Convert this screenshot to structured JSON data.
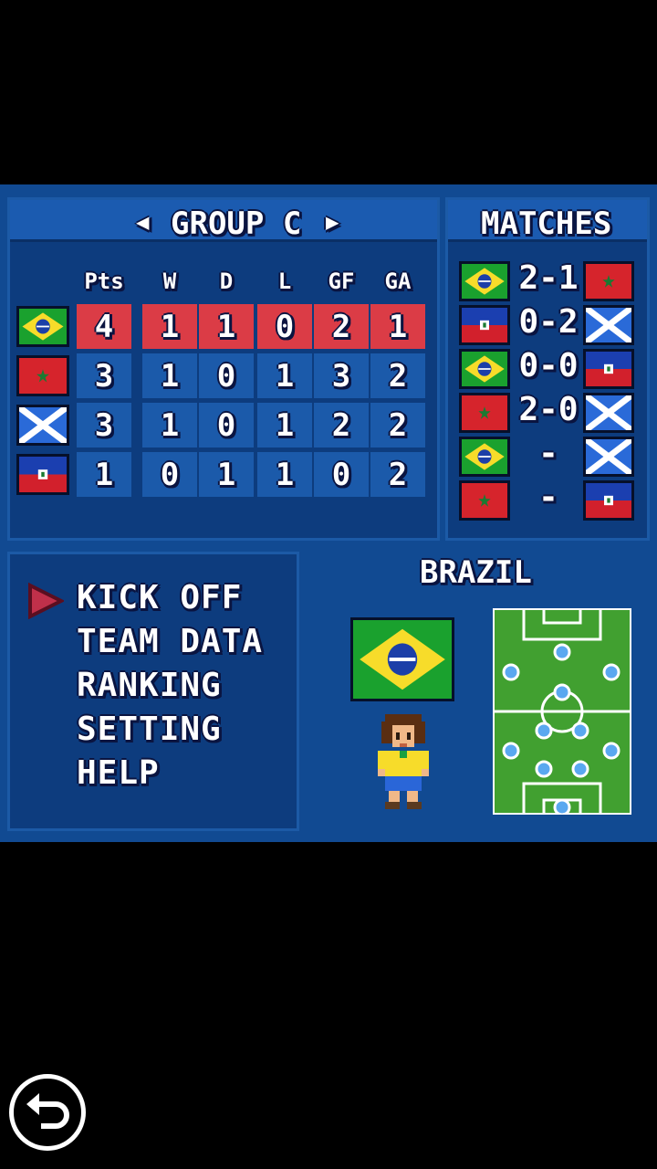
{
  "group": {
    "title": "GROUP C",
    "prev_icon": "triangle-left-icon",
    "next_icon": "triangle-right-icon"
  },
  "matches_title": "MATCHES",
  "columns": [
    "Pts",
    "W",
    "D",
    "L",
    "GF",
    "GA"
  ],
  "standings": [
    {
      "team": "brazil-flag",
      "values": [
        "4",
        "1",
        "1",
        "0",
        "2",
        "1"
      ],
      "highlight": true
    },
    {
      "team": "morocco-flag",
      "values": [
        "3",
        "1",
        "0",
        "1",
        "3",
        "2"
      ],
      "highlight": false
    },
    {
      "team": "scotland-flag",
      "values": [
        "3",
        "1",
        "0",
        "1",
        "2",
        "2"
      ],
      "highlight": false
    },
    {
      "team": "haiti-flag",
      "values": [
        "1",
        "0",
        "1",
        "1",
        "0",
        "2"
      ],
      "highlight": false
    }
  ],
  "matches": [
    {
      "home": "brazil-flag",
      "score": "2-1",
      "away": "morocco-flag"
    },
    {
      "home": "haiti-flag",
      "score": "0-2",
      "away": "scotland-flag"
    },
    {
      "home": "brazil-flag",
      "score": "0-0",
      "away": "haiti-flag"
    },
    {
      "home": "morocco-flag",
      "score": "2-0",
      "away": "scotland-flag"
    },
    {
      "home": "brazil-flag",
      "score": "-",
      "away": "scotland-flag"
    },
    {
      "home": "morocco-flag",
      "score": "-",
      "away": "haiti-flag"
    }
  ],
  "menu": {
    "cursor_icon": "triangle-right-cursor-icon",
    "items": [
      "KICK OFF",
      "TEAM DATA",
      "RANKING",
      "SETTING",
      "HELP"
    ]
  },
  "team": {
    "name": "BRAZIL",
    "flag": "brazil-flag",
    "player": "player-sprite",
    "formation": "formation-pitch"
  },
  "back_icon": "back-arrow-icon",
  "colors": {
    "panel": "#0d3c7e",
    "header": "#1b5bb0",
    "cell": "#1b5aaa",
    "highlight": "#db3c46",
    "cursor": "#c0304a"
  }
}
